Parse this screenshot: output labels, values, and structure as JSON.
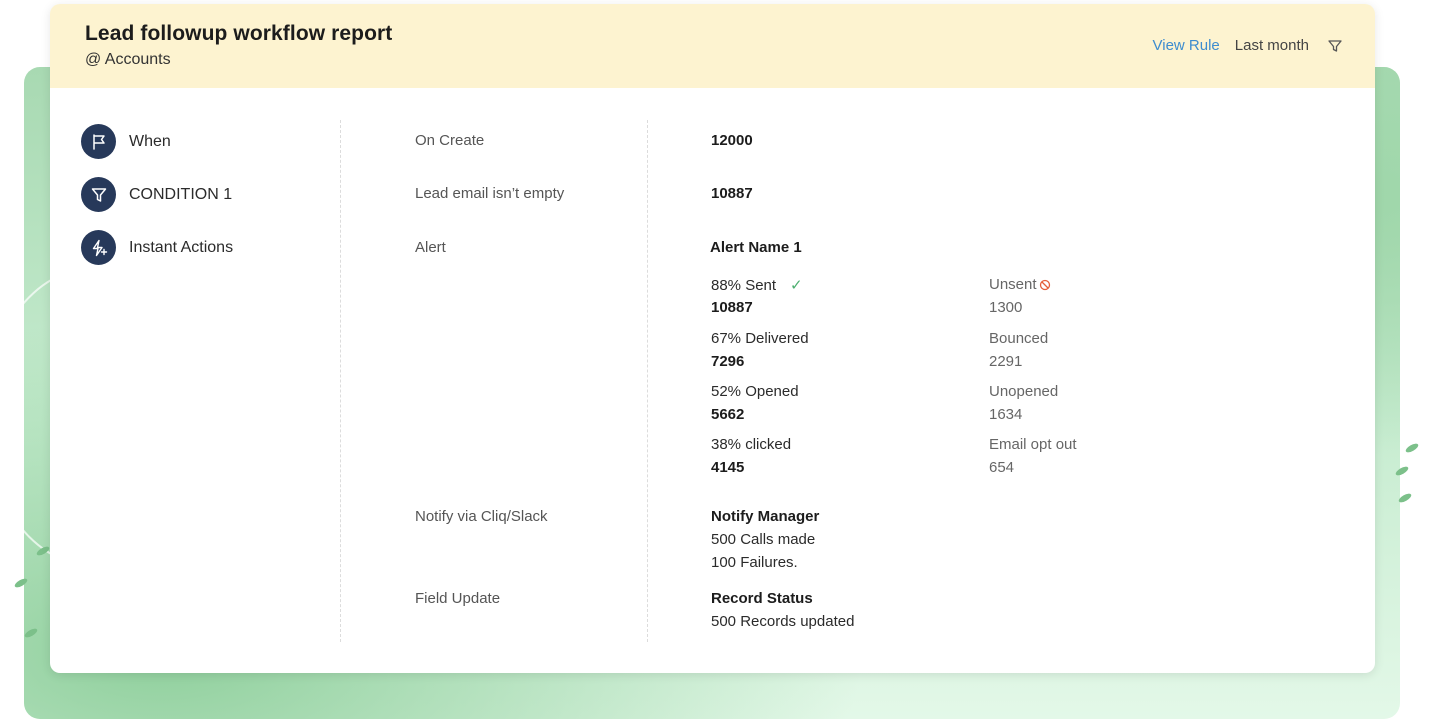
{
  "header": {
    "title": "Lead followup workflow report",
    "subtitle": "@ Accounts",
    "view_rule": "View Rule",
    "period": "Last month"
  },
  "steps": [
    {
      "label": "When",
      "icon": "flag-icon"
    },
    {
      "label": "CONDITION 1",
      "icon": "funnel-icon"
    },
    {
      "label": "Instant Actions",
      "icon": "lightning-plus-icon"
    }
  ],
  "rows": {
    "on_create": {
      "label": "On Create",
      "value": "12000"
    },
    "condition": {
      "label": "Lead email isn’t empty",
      "value": "10887"
    },
    "alert": {
      "label": "Alert",
      "name": "Alert Name 1",
      "stats": [
        {
          "left_label": "88% Sent",
          "left_value": "10887",
          "right_label": "Unsent",
          "right_value": "1300"
        },
        {
          "left_label": "67% Delivered",
          "left_value": "7296",
          "right_label": "Bounced",
          "right_value": "2291"
        },
        {
          "left_label": "52% Opened",
          "left_value": "5662",
          "right_label": "Unopened",
          "right_value": "1634"
        },
        {
          "left_label": "38% clicked",
          "left_value": "4145",
          "right_label": "Email opt out",
          "right_value": "654"
        }
      ]
    },
    "notify": {
      "label": "Notify via Cliq/Slack",
      "title": "Notify Manager",
      "line1": "500 Calls made",
      "line2": "100 Failures."
    },
    "field_update": {
      "label": "Field Update",
      "title": "Record Status",
      "line1": "500 Records updated"
    }
  },
  "colors": {
    "header_bg": "#fdf3d0",
    "accent_link": "#3d8ccf",
    "step_icon_bg": "#27395a",
    "success": "#4caf70",
    "blocked": "#e5603a",
    "backdrop_green": "#a8d9b2"
  }
}
